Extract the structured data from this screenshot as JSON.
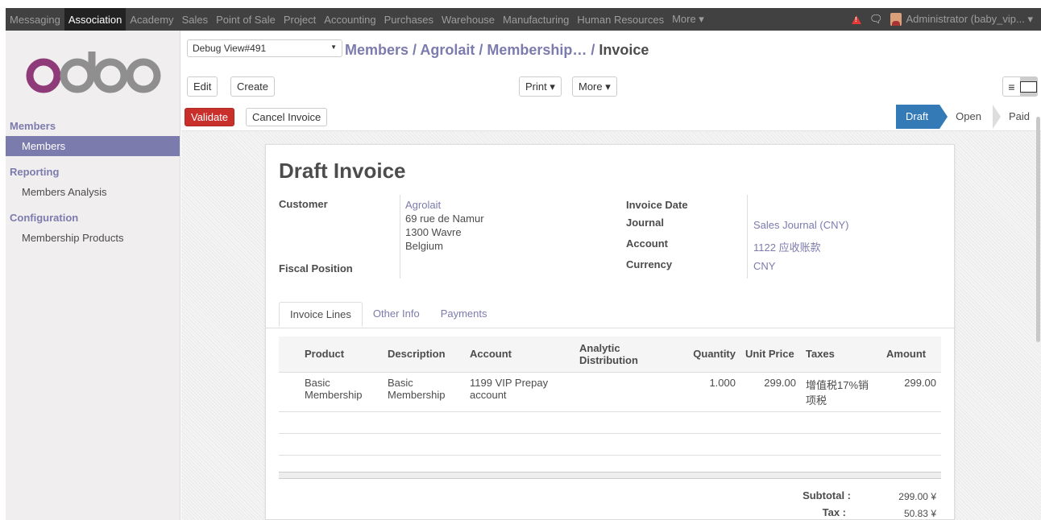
{
  "topmenu": {
    "items": [
      "Messaging",
      "Association",
      "Academy",
      "Sales",
      "Point of Sale",
      "Project",
      "Accounting",
      "Purchases",
      "Warehouse",
      "Manufacturing",
      "Human Resources",
      "More ▾"
    ],
    "active": "Association",
    "user": "Administrator (baby_vip... ▾",
    "icons": [
      "alert-icon",
      "chat-icon"
    ]
  },
  "logo": {
    "text": "odoo",
    "colors": {
      "o1": "#8f3b79",
      "rest": "#8f8f8f"
    }
  },
  "sidebar": {
    "sections": [
      {
        "title": "Members",
        "items": [
          "Members"
        ]
      },
      {
        "title": "Reporting",
        "items": [
          "Members Analysis"
        ]
      },
      {
        "title": "Configuration",
        "items": [
          "Membership Products"
        ]
      }
    ],
    "active_item": "Members"
  },
  "control_panel": {
    "debug_select": "Debug View#491",
    "breadcrumb": {
      "path": "Members / Agrolait / Membership… / ",
      "current": "Invoice"
    },
    "buttons": {
      "edit": "Edit",
      "create": "Create",
      "print": "Print ▾",
      "more": "More ▾"
    }
  },
  "statusbar": {
    "validate": "Validate",
    "cancel_invoice": "Cancel Invoice",
    "stages": [
      "Draft",
      "Open",
      "Paid"
    ],
    "active_stage": "Draft"
  },
  "invoice": {
    "title": "Draft Invoice",
    "labels": {
      "customer": "Customer",
      "fiscal_position": "Fiscal Position",
      "invoice_date": "Invoice Date",
      "journal": "Journal",
      "account": "Account",
      "currency": "Currency"
    },
    "customer": {
      "name": "Agrolait",
      "address1": "69 rue de Namur",
      "address2": "1300 Wavre",
      "country": "Belgium"
    },
    "invoice_date": "",
    "journal": "Sales Journal (CNY)",
    "account": "1122 应收账款",
    "currency": "CNY",
    "tabs": [
      "Invoice Lines",
      "Other Info",
      "Payments"
    ],
    "active_tab": "Invoice Lines",
    "columns": [
      "Product",
      "Description",
      "Account",
      "Analytic Distribution",
      "Quantity",
      "Unit Price",
      "Taxes",
      "Amount"
    ],
    "lines": [
      {
        "product": "Basic Membership",
        "description": "Basic Membership",
        "account": "1199 VIP Prepay account",
        "analytic": "",
        "quantity": "1.000",
        "unit_price": "299.00",
        "taxes": "增值税17%销项税",
        "amount": "299.00"
      }
    ],
    "totals": {
      "subtotal_label": "Subtotal :",
      "subtotal": "299.00 ¥",
      "tax_label": "Tax :",
      "tax": "50.83 ¥"
    }
  },
  "colors": {
    "brand": "#7c7bad",
    "topbar": "#414141",
    "validate": "#c9302c",
    "stage_active": "#337ab7"
  }
}
